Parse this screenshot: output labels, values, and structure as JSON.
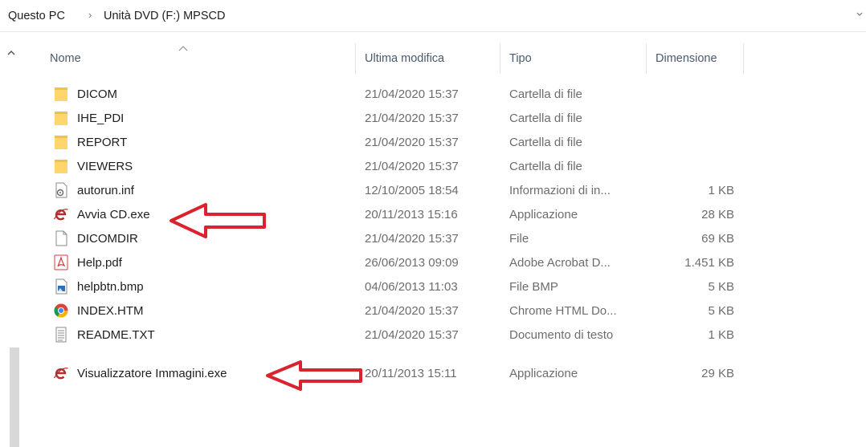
{
  "breadcrumb": {
    "root": "Questo PC",
    "separator": "›",
    "current": "Unità DVD (F:) MPSCD"
  },
  "columns": {
    "name": "Nome",
    "modified": "Ultima modifica",
    "type": "Tipo",
    "size": "Dimensione"
  },
  "files": [
    {
      "name": "DICOM",
      "modified": "21/04/2020 15:37",
      "type": "Cartella di file",
      "size": "",
      "icon": "folder-icon"
    },
    {
      "name": "IHE_PDI",
      "modified": "21/04/2020 15:37",
      "type": "Cartella di file",
      "size": "",
      "icon": "folder-icon"
    },
    {
      "name": "REPORT",
      "modified": "21/04/2020 15:37",
      "type": "Cartella di file",
      "size": "",
      "icon": "folder-icon"
    },
    {
      "name": "VIEWERS",
      "modified": "21/04/2020 15:37",
      "type": "Cartella di file",
      "size": "",
      "icon": "folder-icon"
    },
    {
      "name": "autorun.inf",
      "modified": "12/10/2005 18:54",
      "type": "Informazioni di in...",
      "size": "1 KB",
      "icon": "settings-file-icon"
    },
    {
      "name": "Avvia CD.exe",
      "modified": "20/11/2013 15:16",
      "type": "Applicazione",
      "size": "28 KB",
      "icon": "internet-explorer-icon"
    },
    {
      "name": "DICOMDIR",
      "modified": "21/04/2020 15:37",
      "type": "File",
      "size": "69 KB",
      "icon": "blank-file-icon"
    },
    {
      "name": "Help.pdf",
      "modified": "26/06/2013 09:09",
      "type": "Adobe Acrobat D...",
      "size": "1.451 KB",
      "icon": "pdf-icon"
    },
    {
      "name": "helpbtn.bmp",
      "modified": "04/06/2013 11:03",
      "type": "File BMP",
      "size": "5 KB",
      "icon": "image-file-icon"
    },
    {
      "name": "INDEX.HTM",
      "modified": "21/04/2020 15:37",
      "type": "Chrome HTML Do...",
      "size": "5 KB",
      "icon": "chrome-icon"
    },
    {
      "name": "README.TXT",
      "modified": "21/04/2020 15:37",
      "type": "Documento di testo",
      "size": "1 KB",
      "icon": "text-file-icon"
    },
    {
      "name": "Visualizzatore Immagini.exe",
      "modified": "20/11/2013 15:11",
      "type": "Applicazione",
      "size": "29 KB",
      "icon": "internet-explorer-icon"
    }
  ],
  "colors": {
    "arrow": "#d9232d",
    "folder": "#ffd66b",
    "header_text": "#4a5a6e"
  }
}
